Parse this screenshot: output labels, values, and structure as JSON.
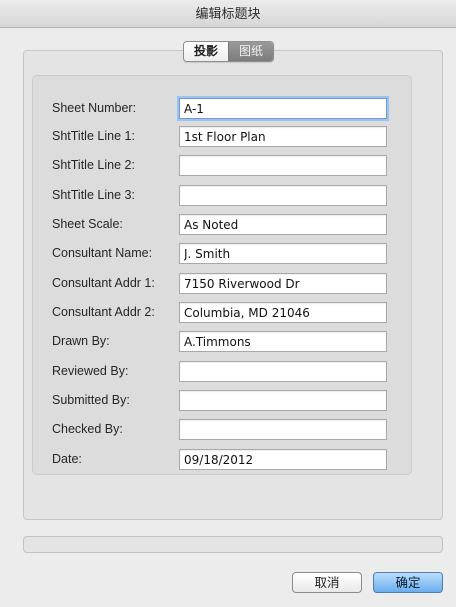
{
  "window": {
    "title": "编辑标题块"
  },
  "tabs": [
    {
      "label": "投影",
      "active": true
    },
    {
      "label": "图纸",
      "active": false
    }
  ],
  "fields": [
    {
      "label": "Sheet Number:",
      "value": "A-1"
    },
    {
      "label": "ShtTitle Line 1:",
      "value": "1st Floor Plan"
    },
    {
      "label": "ShtTitle Line 2:",
      "value": ""
    },
    {
      "label": "ShtTitle Line 3:",
      "value": ""
    },
    {
      "label": "Sheet Scale:",
      "value": "As Noted"
    },
    {
      "label": "Consultant Name:",
      "value": "J. Smith"
    },
    {
      "label": "Consultant Addr 1:",
      "value": "7150 Riverwood Dr"
    },
    {
      "label": "Consultant Addr 2:",
      "value": "Columbia, MD 21046"
    },
    {
      "label": "Drawn By:",
      "value": "A.Timmons"
    },
    {
      "label": "Reviewed By:",
      "value": ""
    },
    {
      "label": "Submitted By:",
      "value": ""
    },
    {
      "label": "Checked By:",
      "value": ""
    },
    {
      "label": "Date:",
      "value": "09/18/2012"
    }
  ],
  "buttons": {
    "cancel": "取消",
    "ok": "确定"
  },
  "colors": {
    "accent": "#6aaef0",
    "focus_ring": "#9fc1ef"
  }
}
